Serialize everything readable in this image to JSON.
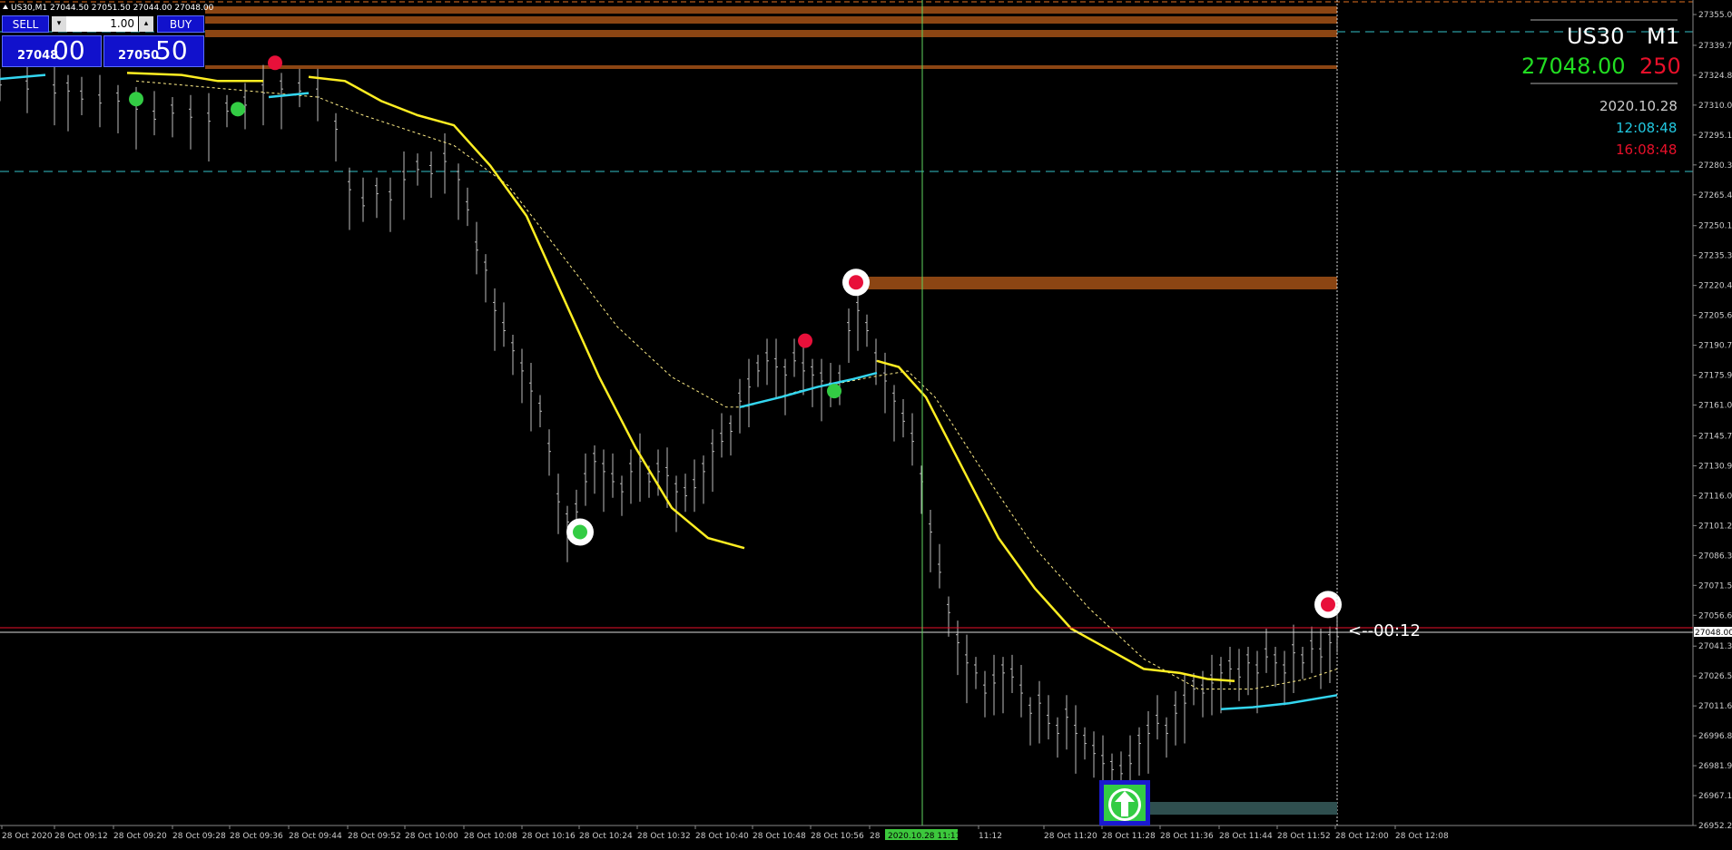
{
  "header": {
    "symbol_info": "US30,M1  27044.50 27051.50 27044.00 27048.00"
  },
  "trade_panel": {
    "sell_label": "SELL",
    "buy_label": "BUY",
    "lot_value": "1.00",
    "lot_down": "▾",
    "lot_up": "▴",
    "sell_price_small": "27048",
    "sell_price_big": "00",
    "buy_price_small": "27050",
    "buy_price_big": "50"
  },
  "info_panel": {
    "symbol": "US30",
    "timeframe": "M1",
    "bid": "27048.00",
    "spread": "250",
    "date": "2020.10.28",
    "time_local": "12:08:48",
    "time_server": "16:08:48",
    "colors": {
      "bid": "#22dd22",
      "spread": "#e8102a",
      "time_local": "#22c8e0",
      "time_server": "#e8102a",
      "date": "#cccccc"
    }
  },
  "countdown": "<--00:12",
  "price_tag": "27048.00",
  "crosshair_time_label": "2020.10.28 11:11",
  "chart_data": {
    "type": "ohlc",
    "symbol": "US30",
    "timeframe": "M1",
    "y_ticks": [
      "27355.00",
      "27339.70",
      "27324.85",
      "27310.00",
      "27295.15",
      "27280.30",
      "27265.45",
      "27250.15",
      "27235.30",
      "27220.45",
      "27205.60",
      "27190.75",
      "27175.90",
      "27161.05",
      "27145.75",
      "27130.90",
      "27116.05",
      "27101.20",
      "27086.35",
      "27071.50",
      "27056.65",
      "27041.35",
      "27026.50",
      "27011.65",
      "26996.80",
      "26981.95",
      "26967.10",
      "26952.25"
    ],
    "x_ticks": [
      "28 Oct 2020",
      "28 Oct 09:12",
      "28 Oct 09:20",
      "28 Oct 09:28",
      "28 Oct 09:36",
      "28 Oct 09:44",
      "28 Oct 09:52",
      "28 Oct 10:00",
      "28 Oct 10:08",
      "28 Oct 10:16",
      "28 Oct 10:24",
      "28 Oct 10:32",
      "28 Oct 10:40",
      "28 Oct 10:48",
      "28 Oct 10:56",
      "28",
      "11:12",
      "28 Oct 11:20",
      "28 Oct 11:28",
      "28 Oct 11:36",
      "28 Oct 11:44",
      "28 Oct 11:52",
      "28 Oct 12:00",
      "28 Oct 12:08"
    ],
    "series_colors": {
      "bars": "#bbbbbb",
      "slow_ma": "#ffee22",
      "fast_ma": "#33d6f0",
      "signal_ma": "#ffee88",
      "zones": "#8b4513",
      "green_dots": "#33cc44",
      "red_dots": "#e8103a",
      "bid_line": "#dddddd",
      "ask_line": "#e8102a",
      "crosshair": "#5fd35f"
    },
    "bid": 27048.0
  }
}
